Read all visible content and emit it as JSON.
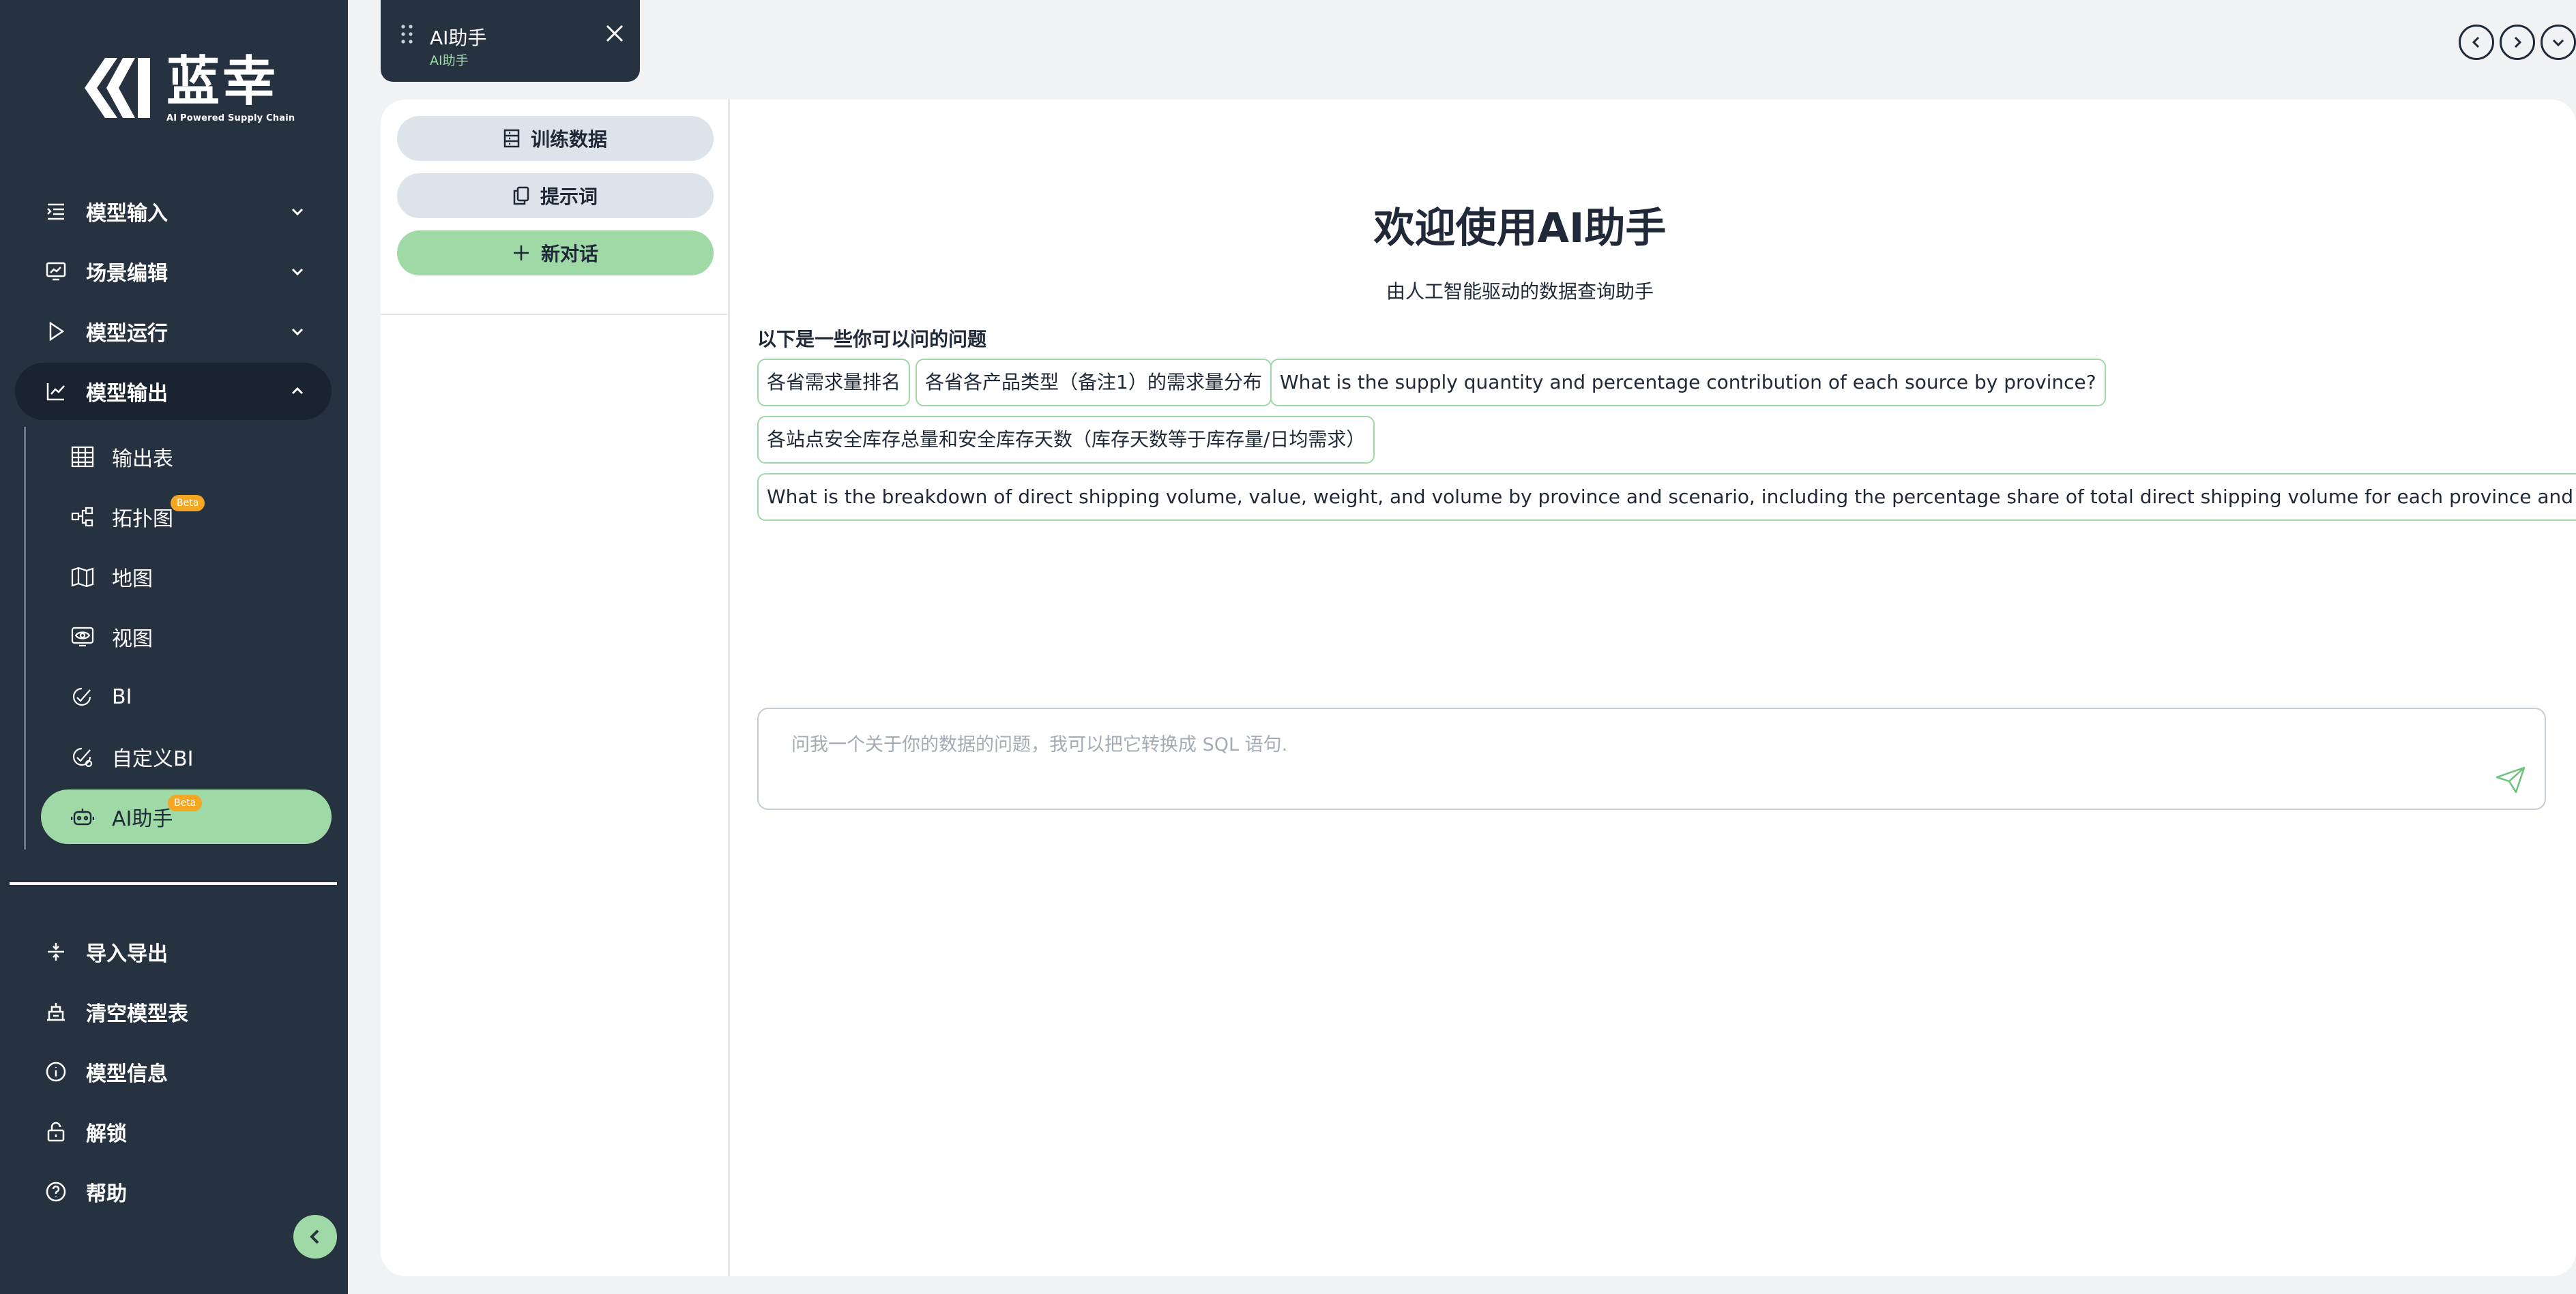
{
  "brand": {
    "name": "蓝幸",
    "tagline": "AI Powered Supply Chain"
  },
  "sidebar": {
    "menu": [
      {
        "label": "模型输入",
        "icon": "indent-list-icon",
        "expanded": false
      },
      {
        "label": "场景编辑",
        "icon": "monitor-chart-icon",
        "expanded": false
      },
      {
        "label": "模型运行",
        "icon": "play-icon",
        "expanded": false
      },
      {
        "label": "模型输出",
        "icon": "line-chart-icon",
        "expanded": true
      }
    ],
    "submenu": [
      {
        "label": "输出表",
        "icon": "table-icon"
      },
      {
        "label": "拓扑图",
        "icon": "topology-icon",
        "badge": "Beta"
      },
      {
        "label": "地图",
        "icon": "map-icon"
      },
      {
        "label": "视图",
        "icon": "eye-view-icon"
      },
      {
        "label": "BI",
        "icon": "bi-analytics-icon"
      },
      {
        "label": "自定义BI",
        "icon": "custom-bi-icon"
      },
      {
        "label": "AI助手",
        "icon": "robot-icon",
        "badge": "Beta",
        "active": true
      }
    ],
    "bottom": [
      {
        "label": "导入导出",
        "icon": "import-export-icon"
      },
      {
        "label": "清空模型表",
        "icon": "clear-table-icon"
      },
      {
        "label": "模型信息",
        "icon": "info-icon"
      },
      {
        "label": "解锁",
        "icon": "unlock-icon"
      },
      {
        "label": "帮助",
        "icon": "help-icon"
      }
    ]
  },
  "tab": {
    "title": "AI助手",
    "subtitle": "AI助手"
  },
  "left_panel": {
    "training_data": "训练数据",
    "prompts": "提示词",
    "new_chat": "新对话"
  },
  "main": {
    "welcome_title": "欢迎使用AI助手",
    "welcome_subtitle": "由人工智能驱动的数据查询助手",
    "suggestions_title": "以下是一些你可以问的问题",
    "suggestions": [
      "各省需求量排名",
      "各省各产品类型（备注1）的需求量分布",
      "What is the supply quantity and percentage contribution of each source by province?",
      "各站点安全库存总量和安全库存天数（库存天数等于库存量/日均需求）",
      "What is the breakdown of direct shipping volume, value, weight, and volume by province and scenario, including the percentage share of total direct shipping volume for each province and scenario?"
    ],
    "input_placeholder": "问我一个关于你的数据的问题，我可以把它转换成 SQL 语句."
  },
  "colors": {
    "sidebar_bg": "#263240",
    "accent_green": "#9ed9a6",
    "badge_orange": "#f5a623",
    "page_bg": "#f0f2f3"
  }
}
